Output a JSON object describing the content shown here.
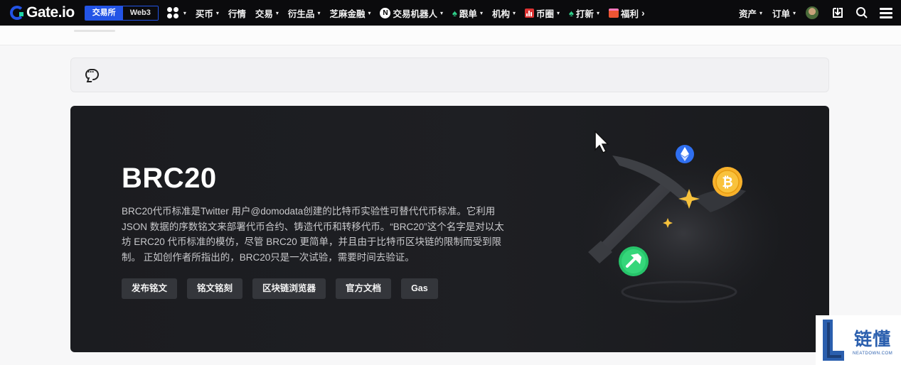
{
  "nav": {
    "logo_text": "Gate.io",
    "mode_active": "交易所",
    "mode_inactive": "Web3",
    "items": [
      {
        "label": "买币",
        "caret": true
      },
      {
        "label": "行情",
        "caret": false
      },
      {
        "label": "交易",
        "caret": true
      },
      {
        "label": "衍生品",
        "caret": true
      },
      {
        "label": "芝麻金融",
        "caret": true
      },
      {
        "label": "交易机器人",
        "caret": true
      },
      {
        "label": "跟单",
        "caret": true
      },
      {
        "label": "机构",
        "caret": true
      },
      {
        "label": "币圈",
        "caret": true
      },
      {
        "label": "打新",
        "caret": true
      },
      {
        "label": "福利",
        "caret": false,
        "chevron": "›"
      }
    ],
    "right_items": [
      {
        "label": "资产",
        "caret": true
      },
      {
        "label": "订单",
        "caret": true
      }
    ],
    "caret_glyph": "▾",
    "colors": {
      "brand_blue": "#2354e6",
      "nav_bg": "#0b0b0d",
      "green": "#2fd08a"
    }
  },
  "banner": {
    "title": "BRC20",
    "description": "BRC20代币标准是Twitter 用户@domodata创建的比特币实验性可替代代币标准。它利用 JSON 数据的序数铭文来部署代币合约、铸造代币和转移代币。“BRC20”这个名字是对以太坊 ERC20 代币标准的模仿，尽管 BRC20 更简单，并且由于比特币区块链的限制而受到限制。 正如创作者所指出的，BRC20只是一次试验，需要时间去验证。",
    "buttons": [
      "发布铭文",
      "铭文铭刻",
      "区块链浏览器",
      "官方文档",
      "Gas"
    ],
    "bitcoin_symbol": "₿",
    "colors": {
      "bg": "#1e1f23",
      "button_bg": "#34363b",
      "bitcoin": "#f7b12b",
      "eth": "#2f6ff0",
      "hammer_badge": "#27c46a"
    }
  },
  "watermark": {
    "cn": "链懂",
    "en": "NEATDOWN.COM"
  }
}
